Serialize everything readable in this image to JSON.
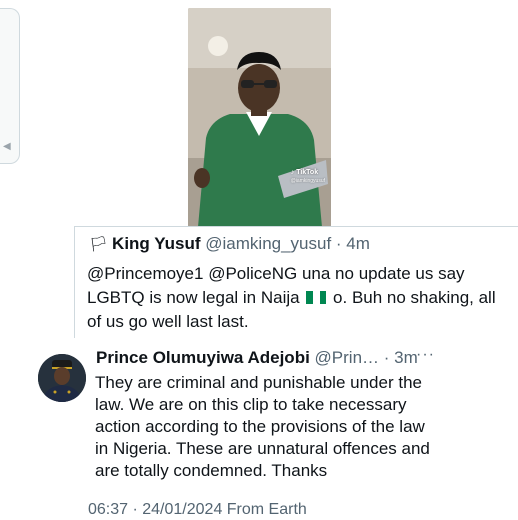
{
  "video": {
    "watermark_brand": "TikTok",
    "watermark_handle": "@iamkingyusuf"
  },
  "quoted_tweet": {
    "name_emoji": "🏳",
    "name": "King Yusuf",
    "meta": "@iamking_yusuf · 4m",
    "text_before_flag": "@Princemoye1 @PoliceNG una no update us say LGBTQ is now legal in Naija",
    "text_after_flag": " o. Buh no shaking, all of us go well last last.",
    "flag_colors": [
      "#008751",
      "#ffffff",
      "#008751"
    ]
  },
  "reply_tweet": {
    "name": "Prince Olumuyiwa Adejobi",
    "meta": "@Prin… · 3m",
    "more_label": "···",
    "text": "They are criminal and punishable under the law. We are on this clip to take necessary action according to the provisions of the law in Nigeria. These are unnatural offences and are totally condemned. Thanks",
    "timestamp": "06:37 · 24/01/2024 From Earth"
  },
  "colors": {
    "secondary_text": "#536471",
    "border": "#cfd9de",
    "shirt": "#2f7a4c"
  }
}
